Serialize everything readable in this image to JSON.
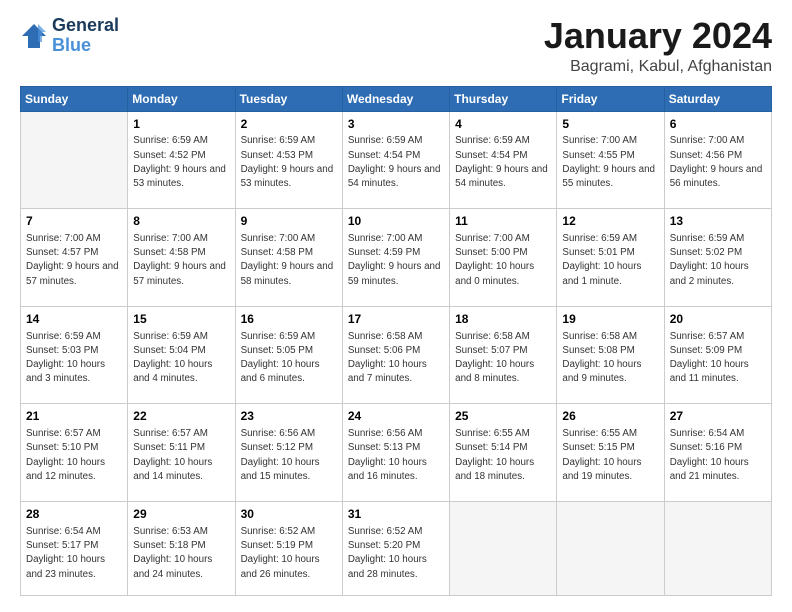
{
  "logo": {
    "line1": "General",
    "line2": "Blue"
  },
  "title": "January 2024",
  "subtitle": "Bagrami, Kabul, Afghanistan",
  "days_of_week": [
    "Sunday",
    "Monday",
    "Tuesday",
    "Wednesday",
    "Thursday",
    "Friday",
    "Saturday"
  ],
  "weeks": [
    [
      {
        "date": "",
        "info": ""
      },
      {
        "date": "1",
        "info": "Sunrise: 6:59 AM\nSunset: 4:52 PM\nDaylight: 9 hours\nand 53 minutes."
      },
      {
        "date": "2",
        "info": "Sunrise: 6:59 AM\nSunset: 4:53 PM\nDaylight: 9 hours\nand 53 minutes."
      },
      {
        "date": "3",
        "info": "Sunrise: 6:59 AM\nSunset: 4:54 PM\nDaylight: 9 hours\nand 54 minutes."
      },
      {
        "date": "4",
        "info": "Sunrise: 6:59 AM\nSunset: 4:54 PM\nDaylight: 9 hours\nand 54 minutes."
      },
      {
        "date": "5",
        "info": "Sunrise: 7:00 AM\nSunset: 4:55 PM\nDaylight: 9 hours\nand 55 minutes."
      },
      {
        "date": "6",
        "info": "Sunrise: 7:00 AM\nSunset: 4:56 PM\nDaylight: 9 hours\nand 56 minutes."
      }
    ],
    [
      {
        "date": "7",
        "info": "Sunrise: 7:00 AM\nSunset: 4:57 PM\nDaylight: 9 hours\nand 57 minutes."
      },
      {
        "date": "8",
        "info": "Sunrise: 7:00 AM\nSunset: 4:58 PM\nDaylight: 9 hours\nand 57 minutes."
      },
      {
        "date": "9",
        "info": "Sunrise: 7:00 AM\nSunset: 4:58 PM\nDaylight: 9 hours\nand 58 minutes."
      },
      {
        "date": "10",
        "info": "Sunrise: 7:00 AM\nSunset: 4:59 PM\nDaylight: 9 hours\nand 59 minutes."
      },
      {
        "date": "11",
        "info": "Sunrise: 7:00 AM\nSunset: 5:00 PM\nDaylight: 10 hours\nand 0 minutes."
      },
      {
        "date": "12",
        "info": "Sunrise: 6:59 AM\nSunset: 5:01 PM\nDaylight: 10 hours\nand 1 minute."
      },
      {
        "date": "13",
        "info": "Sunrise: 6:59 AM\nSunset: 5:02 PM\nDaylight: 10 hours\nand 2 minutes."
      }
    ],
    [
      {
        "date": "14",
        "info": "Sunrise: 6:59 AM\nSunset: 5:03 PM\nDaylight: 10 hours\nand 3 minutes."
      },
      {
        "date": "15",
        "info": "Sunrise: 6:59 AM\nSunset: 5:04 PM\nDaylight: 10 hours\nand 4 minutes."
      },
      {
        "date": "16",
        "info": "Sunrise: 6:59 AM\nSunset: 5:05 PM\nDaylight: 10 hours\nand 6 minutes."
      },
      {
        "date": "17",
        "info": "Sunrise: 6:58 AM\nSunset: 5:06 PM\nDaylight: 10 hours\nand 7 minutes."
      },
      {
        "date": "18",
        "info": "Sunrise: 6:58 AM\nSunset: 5:07 PM\nDaylight: 10 hours\nand 8 minutes."
      },
      {
        "date": "19",
        "info": "Sunrise: 6:58 AM\nSunset: 5:08 PM\nDaylight: 10 hours\nand 9 minutes."
      },
      {
        "date": "20",
        "info": "Sunrise: 6:57 AM\nSunset: 5:09 PM\nDaylight: 10 hours\nand 11 minutes."
      }
    ],
    [
      {
        "date": "21",
        "info": "Sunrise: 6:57 AM\nSunset: 5:10 PM\nDaylight: 10 hours\nand 12 minutes."
      },
      {
        "date": "22",
        "info": "Sunrise: 6:57 AM\nSunset: 5:11 PM\nDaylight: 10 hours\nand 14 minutes."
      },
      {
        "date": "23",
        "info": "Sunrise: 6:56 AM\nSunset: 5:12 PM\nDaylight: 10 hours\nand 15 minutes."
      },
      {
        "date": "24",
        "info": "Sunrise: 6:56 AM\nSunset: 5:13 PM\nDaylight: 10 hours\nand 16 minutes."
      },
      {
        "date": "25",
        "info": "Sunrise: 6:55 AM\nSunset: 5:14 PM\nDaylight: 10 hours\nand 18 minutes."
      },
      {
        "date": "26",
        "info": "Sunrise: 6:55 AM\nSunset: 5:15 PM\nDaylight: 10 hours\nand 19 minutes."
      },
      {
        "date": "27",
        "info": "Sunrise: 6:54 AM\nSunset: 5:16 PM\nDaylight: 10 hours\nand 21 minutes."
      }
    ],
    [
      {
        "date": "28",
        "info": "Sunrise: 6:54 AM\nSunset: 5:17 PM\nDaylight: 10 hours\nand 23 minutes."
      },
      {
        "date": "29",
        "info": "Sunrise: 6:53 AM\nSunset: 5:18 PM\nDaylight: 10 hours\nand 24 minutes."
      },
      {
        "date": "30",
        "info": "Sunrise: 6:52 AM\nSunset: 5:19 PM\nDaylight: 10 hours\nand 26 minutes."
      },
      {
        "date": "31",
        "info": "Sunrise: 6:52 AM\nSunset: 5:20 PM\nDaylight: 10 hours\nand 28 minutes."
      },
      {
        "date": "",
        "info": ""
      },
      {
        "date": "",
        "info": ""
      },
      {
        "date": "",
        "info": ""
      }
    ]
  ]
}
